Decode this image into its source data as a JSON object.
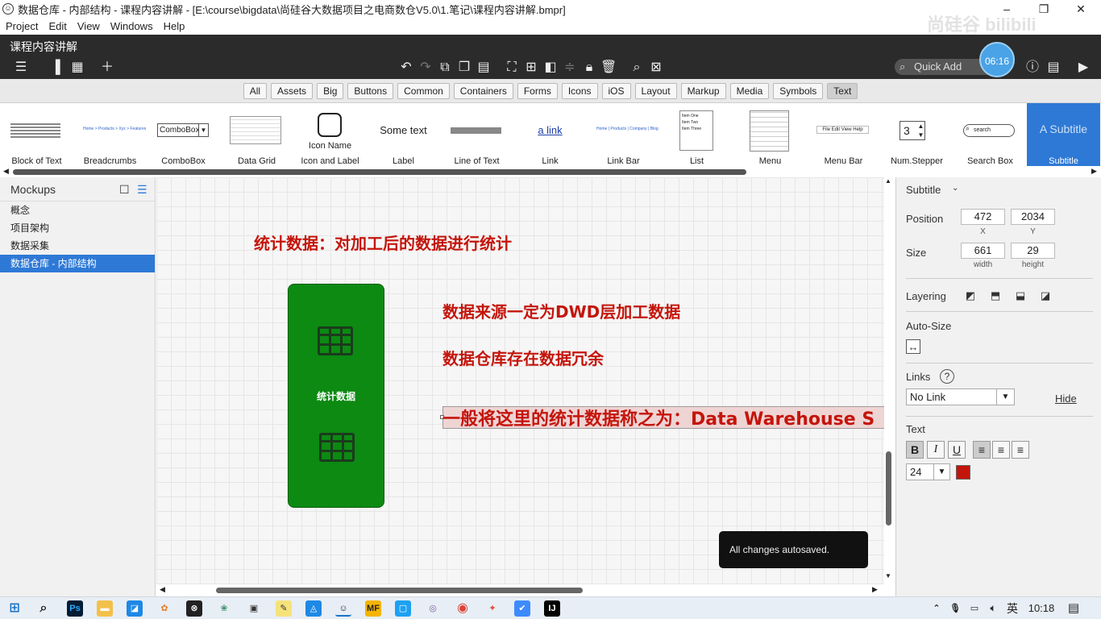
{
  "window": {
    "title": "数据仓库 - 内部结构 - 课程内容讲解 - [E:\\course\\bigdata\\尚硅谷大数据项目之电商数仓V5.0\\1.笔记\\课程内容讲解.bmpr]",
    "minimize": "–",
    "restore": "❐",
    "close": "✕"
  },
  "menu": [
    "Project",
    "Edit",
    "View",
    "Windows",
    "Help"
  ],
  "document_tab": "课程内容讲解",
  "overlay": {
    "watermark": "尚硅谷 bilibili",
    "time": "06:16"
  },
  "quick_add": {
    "placeholder": "Quick Add"
  },
  "filters": [
    "All",
    "Assets",
    "Big",
    "Buttons",
    "Common",
    "Containers",
    "Forms",
    "Icons",
    "iOS",
    "Layout",
    "Markup",
    "Media",
    "Symbols",
    "Text"
  ],
  "selected_filter": "Text",
  "library": [
    {
      "label": "Block of Text",
      "preview": ""
    },
    {
      "label": "Breadcrumbs",
      "preview": "Home > Products > Xyz > Features"
    },
    {
      "label": "ComboBox",
      "preview": "ComboBox"
    },
    {
      "label": "Data Grid",
      "preview": ""
    },
    {
      "label": "Icon and Label",
      "preview": "Icon Name"
    },
    {
      "label": "Label",
      "preview": "Some text"
    },
    {
      "label": "Line of Text",
      "preview": ""
    },
    {
      "label": "Link",
      "preview": "a link"
    },
    {
      "label": "Link Bar",
      "preview": "Home | Products | Company | Blog"
    },
    {
      "label": "List",
      "preview": "Item One\nItem Two\nItem Three"
    },
    {
      "label": "Menu",
      "preview": ""
    },
    {
      "label": "Menu Bar",
      "preview": "File Edit View Help"
    },
    {
      "label": "Num.Stepper",
      "preview": "3"
    },
    {
      "label": "Search Box",
      "preview": "search"
    },
    {
      "label": "Subtitle",
      "preview": "A Subtitle"
    }
  ],
  "mockups": {
    "header": "Mockups",
    "items": [
      "概念",
      "项目架构",
      "数据采集",
      "数据仓库 - 内部结构"
    ],
    "selected_index": 3
  },
  "canvas": {
    "heading": "统计数据：对加工后的数据进行统计",
    "box_label": "统计数据",
    "line1": "数据来源一定为DWD层加工数据",
    "line2": "数据仓库存在数据冗余",
    "line3": "一般将这里的统计数据称之为：Data Warehouse S",
    "green_color": "#0c8a12",
    "text_color": "#c4150b"
  },
  "toast": "All changes autosaved.",
  "properties": {
    "type": "Subtitle",
    "position_label": "Position",
    "x": "472",
    "y": "2034",
    "x_caption": "X",
    "y_caption": "Y",
    "size_label": "Size",
    "width": "661",
    "height": "29",
    "width_caption": "width",
    "height_caption": "height",
    "layering_label": "Layering",
    "autosize_label": "Auto-Size",
    "links_label": "Links",
    "link_value": "No Link",
    "hide_label": "Hide",
    "text_label": "Text",
    "font_size": "24",
    "text_swatch": "#c4150b"
  },
  "taskbar": {
    "ime": "英",
    "clock": "10:18"
  }
}
